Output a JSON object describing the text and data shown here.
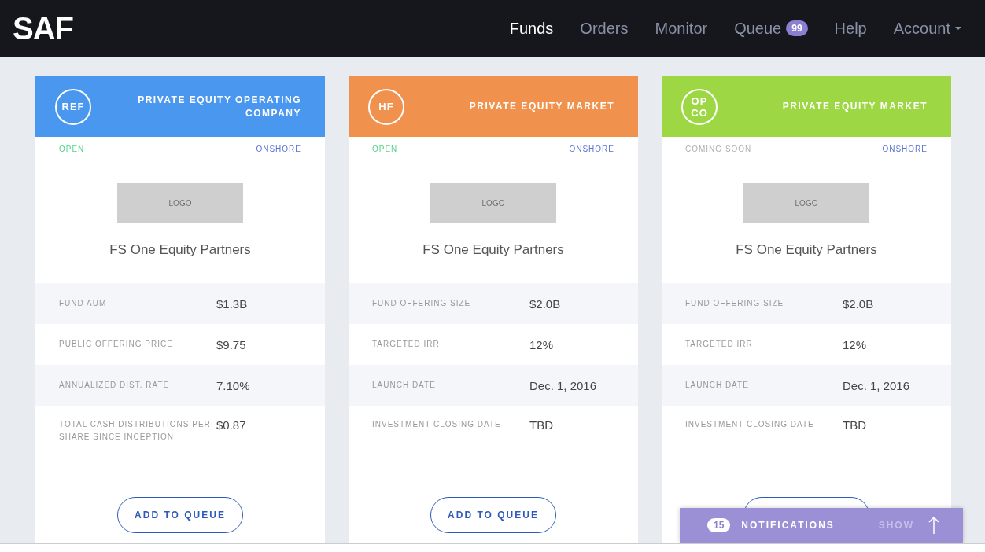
{
  "brand": "SAF",
  "nav": [
    {
      "label": "Funds",
      "selected": true
    },
    {
      "label": "Orders",
      "selected": false
    },
    {
      "label": "Monitor",
      "selected": false
    },
    {
      "label": "Queue",
      "selected": false,
      "badge": "99"
    },
    {
      "label": "Help",
      "selected": false
    },
    {
      "label": "Account",
      "selected": false,
      "dropdown": true
    }
  ],
  "cards": [
    {
      "code": "REF",
      "title": "PRIVATE EQUITY OPERATING COMPANY",
      "color": "#4a97f0",
      "status": {
        "text": "OPEN",
        "color": "#4fd28a"
      },
      "region": "ONSHORE",
      "logo": "LOGO",
      "name": "FS One Equity Partners",
      "stats": [
        {
          "label": "FUND AUM",
          "value": "$1.3B"
        },
        {
          "label": "PUBLIC OFFERING PRICE",
          "value": "$9.75"
        },
        {
          "label": "ANNUALIZED DIST. RATE",
          "value": "7.10%"
        },
        {
          "label": "TOTAL CASH DISTRIBUTIONS PER SHARE SINCE INCEPTION",
          "value": "$0.87"
        }
      ],
      "button": "ADD TO QUEUE"
    },
    {
      "code": "HF",
      "title": "PRIVATE EQUITY MARKET",
      "color": "#f0914d",
      "status": {
        "text": "OPEN",
        "color": "#4fd28a"
      },
      "region": "ONSHORE",
      "logo": "LOGO",
      "name": "FS One Equity Partners",
      "stats": [
        {
          "label": "FUND OFFERING SIZE",
          "value": "$2.0B"
        },
        {
          "label": "TARGETED IRR",
          "value": "12%"
        },
        {
          "label": "LAUNCH DATE",
          "value": "Dec. 1, 2016"
        },
        {
          "label": "INVESTMENT CLOSING DATE",
          "value": "TBD"
        }
      ],
      "button": "ADD TO QUEUE"
    },
    {
      "code": "OP CO",
      "title": "PRIVATE EQUITY MARKET",
      "color": "#9ed744",
      "status": {
        "text": "COMING SOON",
        "color": "#b0b0b0"
      },
      "region": "ONSHORE",
      "logo": "LOGO",
      "name": "FS One Equity Partners",
      "stats": [
        {
          "label": "FUND OFFERING SIZE",
          "value": "$2.0B"
        },
        {
          "label": "TARGETED IRR",
          "value": "12%"
        },
        {
          "label": "LAUNCH DATE",
          "value": "Dec. 1, 2016"
        },
        {
          "label": "INVESTMENT CLOSING DATE",
          "value": "TBD"
        }
      ]
    }
  ],
  "notifications": {
    "count": "15",
    "label": "NOTIFICATIONS",
    "action": "SHOW"
  }
}
